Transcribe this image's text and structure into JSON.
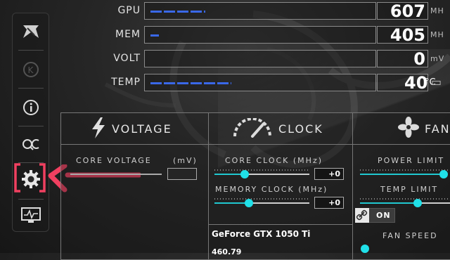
{
  "monitor": [
    {
      "label": "GPU",
      "value": "607",
      "unit": "MH",
      "fill_fraction": 0.25
    },
    {
      "label": "MEM",
      "value": "405",
      "unit": "MH",
      "fill_fraction": 0.04
    },
    {
      "label": "VOLT",
      "value": "0",
      "unit": "mV",
      "fill_fraction": 0
    },
    {
      "label": "TEMP",
      "value": "40",
      "unit_inline": "°C",
      "fill_fraction": 0.37
    }
  ],
  "sidebar": {
    "items": [
      "logo-icon",
      "k-icon",
      "info-icon",
      "oc-scanner-icon",
      "settings-icon",
      "monitor-icon"
    ],
    "selected": "settings-icon"
  },
  "colors": {
    "accent_teal": "#20e0e8",
    "bar_blue": "#3a68e8",
    "annotation_red": "#f04060"
  },
  "voltage": {
    "title": "VOLTAGE",
    "core_voltage_label": "CORE VOLTAGE",
    "core_voltage_unit": "(mV)"
  },
  "clock": {
    "title": "CLOCK",
    "core_clock_label": "CORE CLOCK (MHz)",
    "core_clock_value": "+0",
    "memory_clock_label": "MEMORY CLOCK (MHz)",
    "memory_clock_value": "+0",
    "link_label": "ON",
    "gpu_name": "GeForce GTX 1050 Ti",
    "driver_version": "460.79"
  },
  "fan": {
    "title": "FAN",
    "power_limit_label": "POWER LIMIT",
    "temp_limit_label": "TEMP LIMIT",
    "fan_speed_label": "FAN SPEED"
  }
}
